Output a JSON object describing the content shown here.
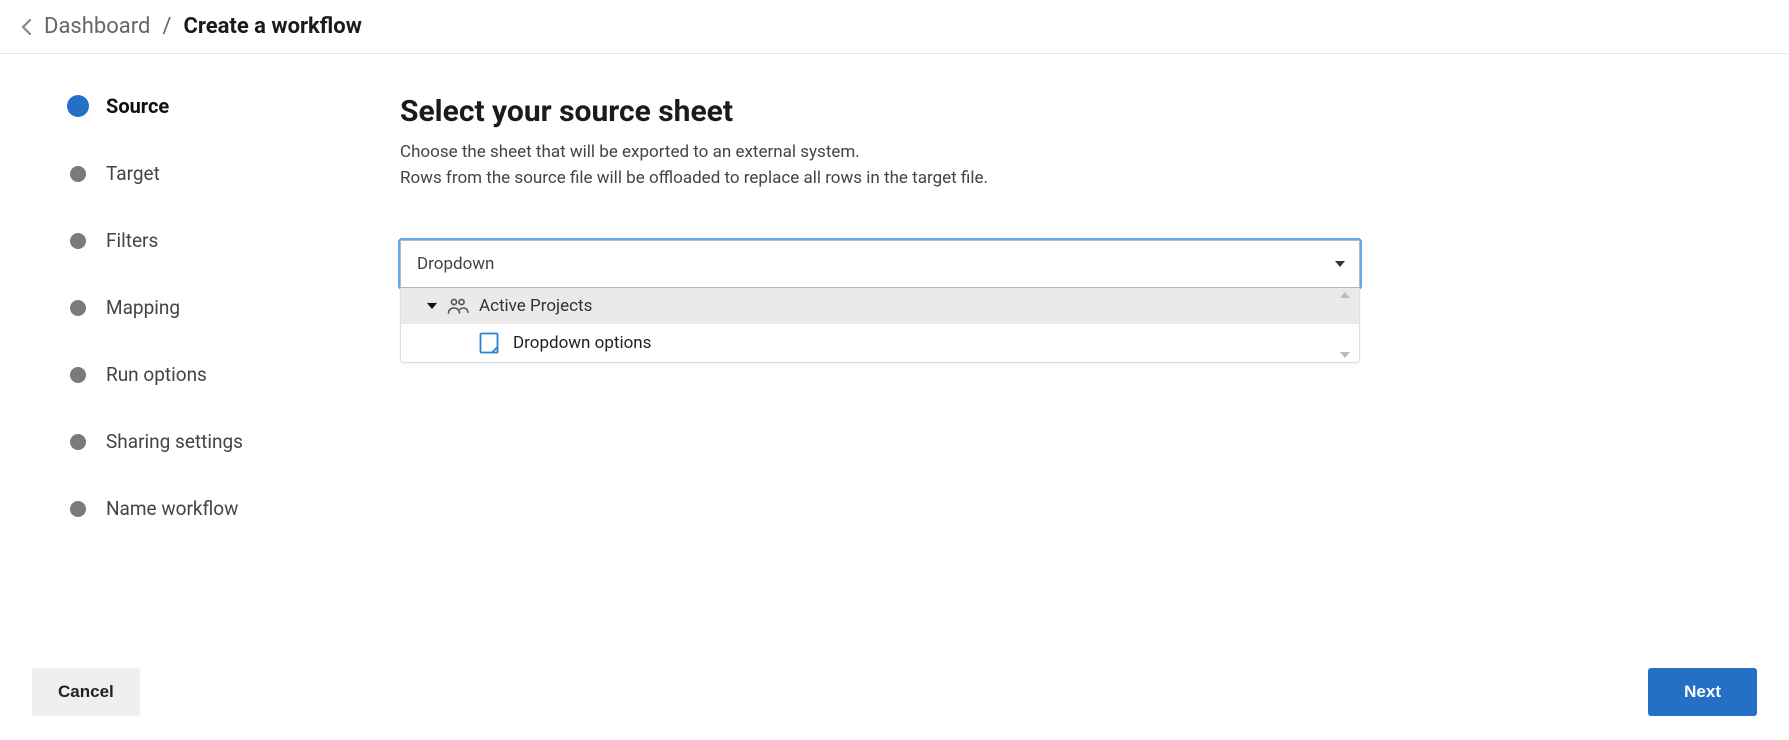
{
  "breadcrumb": {
    "link": "Dashboard",
    "separator": "/",
    "current": "Create a workflow"
  },
  "steps": [
    {
      "label": "Source",
      "active": true
    },
    {
      "label": "Target",
      "active": false
    },
    {
      "label": "Filters",
      "active": false
    },
    {
      "label": "Mapping",
      "active": false
    },
    {
      "label": "Run options",
      "active": false
    },
    {
      "label": "Sharing settings",
      "active": false
    },
    {
      "label": "Name workflow",
      "active": false
    }
  ],
  "main": {
    "title": "Select your source sheet",
    "subtitle_line1": "Choose the sheet that will be exported to an external system.",
    "subtitle_line2": "Rows from the source file will be offloaded to replace all rows in the target file."
  },
  "dropdown": {
    "value": "Dropdown",
    "folder_label": "Active Projects",
    "sheet_label": "Dropdown options"
  },
  "footer": {
    "cancel": "Cancel",
    "next": "Next"
  }
}
